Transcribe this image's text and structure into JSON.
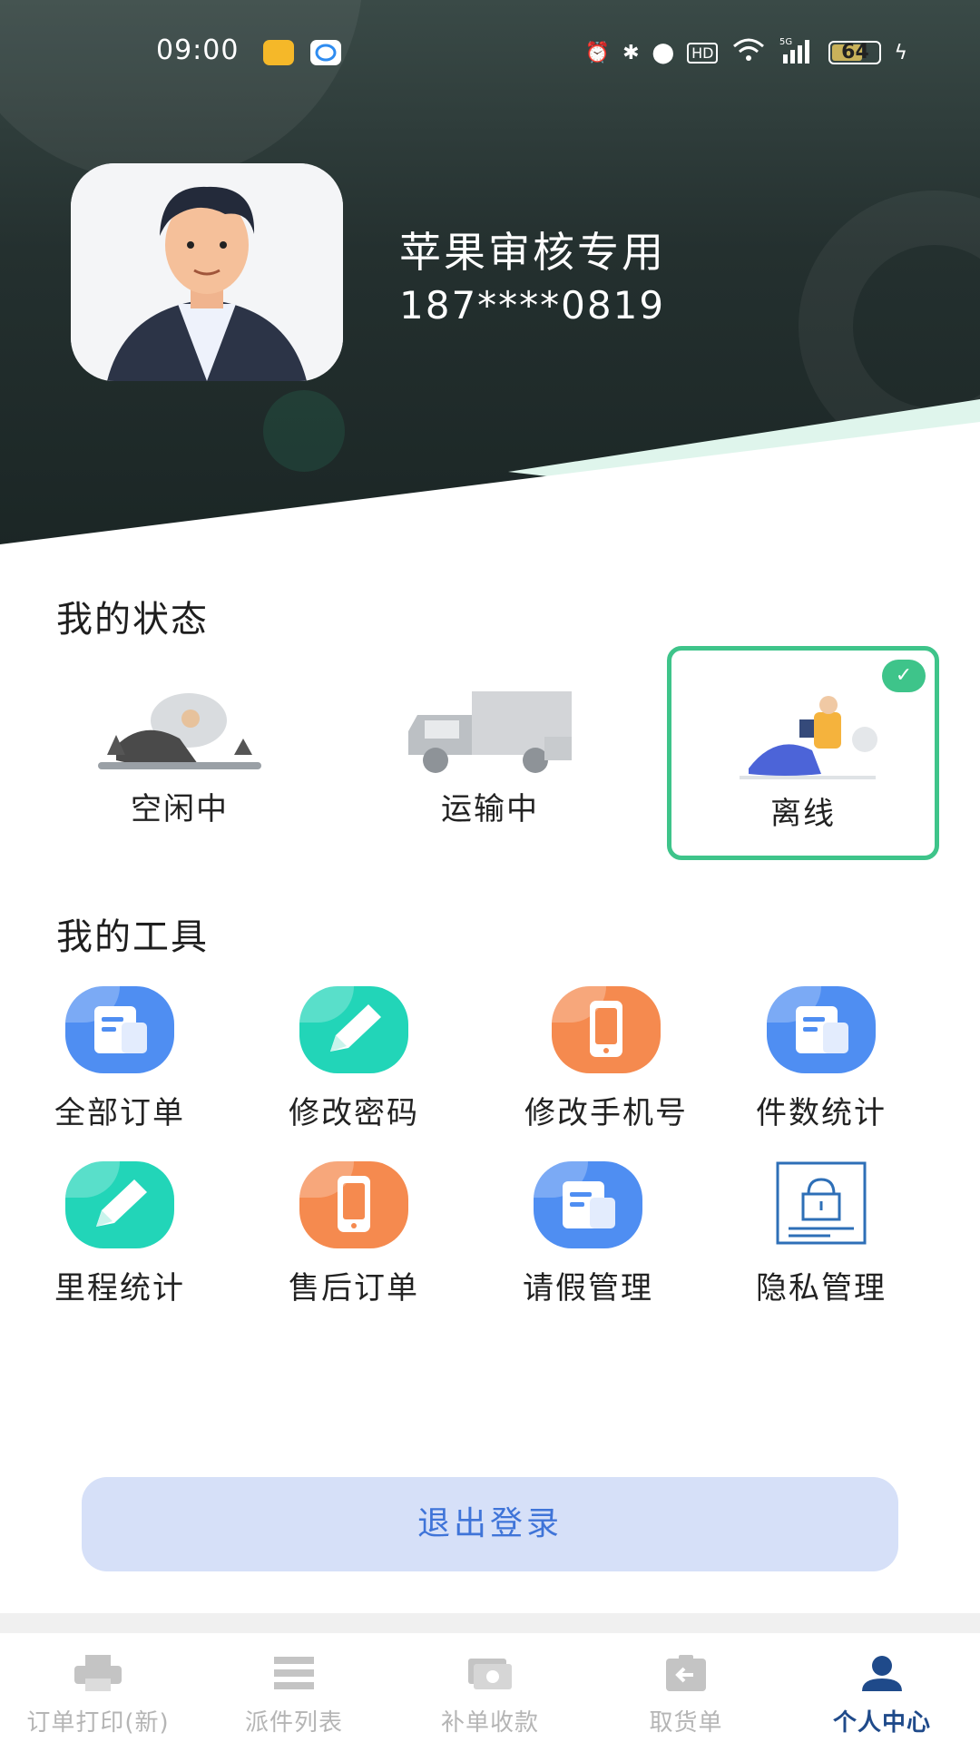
{
  "status_bar": {
    "time": "09:00",
    "battery": "64",
    "network": "5G",
    "hd": "HD"
  },
  "profile": {
    "name": "苹果审核专用",
    "phone": "187****0819"
  },
  "my_status": {
    "title": "我的状态",
    "items": [
      {
        "label": "空闲中",
        "selected": false
      },
      {
        "label": "运输中",
        "selected": false
      },
      {
        "label": "离线",
        "selected": true
      }
    ]
  },
  "my_tools": {
    "title": "我的工具",
    "items": [
      {
        "label": "全部订单",
        "icon": "document-icon",
        "color": "#4f8ef2"
      },
      {
        "label": "修改密码",
        "icon": "pencil-icon",
        "color": "#22d5b8"
      },
      {
        "label": "修改手机号",
        "icon": "phone-icon",
        "color": "#f58a4f"
      },
      {
        "label": "件数统计",
        "icon": "document-icon",
        "color": "#4f8ef2"
      },
      {
        "label": "里程统计",
        "icon": "pencil-icon",
        "color": "#22d5b8"
      },
      {
        "label": "售后订单",
        "icon": "phone-icon",
        "color": "#f58a4f"
      },
      {
        "label": "请假管理",
        "icon": "document-icon",
        "color": "#4f8ef2"
      },
      {
        "label": "隐私管理",
        "icon": "privacy-lock-icon",
        "color": "#2e6fb7"
      }
    ]
  },
  "logout_label": "退出登录",
  "tabs": [
    {
      "label": "订单打印(新)",
      "icon": "printer-icon",
      "active": false
    },
    {
      "label": "派件列表",
      "icon": "list-icon",
      "active": false
    },
    {
      "label": "补单收款",
      "icon": "cash-icon",
      "active": false
    },
    {
      "label": "取货单",
      "icon": "pickup-icon",
      "active": false
    },
    {
      "label": "个人中心",
      "icon": "person-icon",
      "active": true
    }
  ],
  "colors": {
    "accent_green": "#3ec48a",
    "logout_text": "#3f74d8",
    "tab_active": "#1f4a8a"
  }
}
